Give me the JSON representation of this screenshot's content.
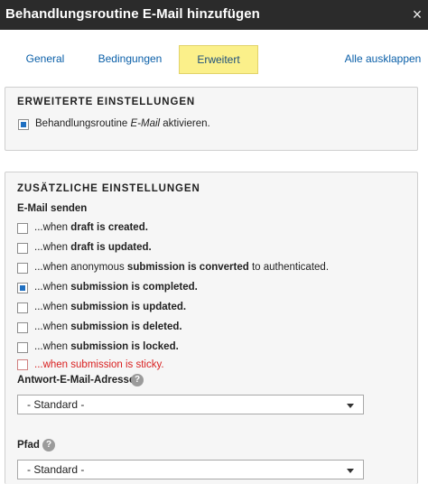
{
  "dialog": {
    "title": "Behandlungsroutine E-Mail hinzufügen",
    "close_icon": "×"
  },
  "tabs": [
    {
      "label": "General"
    },
    {
      "label": "Bedingungen"
    },
    {
      "label": "Erweitert",
      "active": true
    }
  ],
  "expand_all": "Alle ausklappen",
  "advanced": {
    "title": "ERWEITERTE EINSTELLUNGEN",
    "activate": {
      "pre": "Behandlungsroutine ",
      "em": "E-Mail",
      "post": " aktivieren.",
      "checked": true
    }
  },
  "additional": {
    "title": "ZUSÄTZLICHE EINSTELLUNGEN",
    "send_label": "E-Mail senden",
    "options": [
      {
        "pre": "...when ",
        "bold": "draft is created.",
        "post": "",
        "checked": false
      },
      {
        "pre": "...when ",
        "bold": "draft is updated.",
        "post": "",
        "checked": false
      },
      {
        "pre": "...when anonymous ",
        "bold": "submission is converted",
        "post": " to authenticated.",
        "checked": false
      },
      {
        "pre": "...when ",
        "bold": "submission is completed.",
        "post": "",
        "checked": true
      },
      {
        "pre": "...when ",
        "bold": "submission is updated.",
        "post": "",
        "checked": false
      },
      {
        "pre": "...when ",
        "bold": "submission is deleted.",
        "post": "",
        "checked": false
      },
      {
        "pre": "...when ",
        "bold": "submission is locked.",
        "post": "",
        "checked": false
      },
      {
        "pre": "...when submission is sticky.",
        "bold": "",
        "post": "",
        "checked": false
      }
    ],
    "reply_label": "Antwort-E-Mail-Adresse",
    "reply_value": "- Standard -",
    "path_label": "Pfad",
    "path_value": "- Standard -",
    "help_glyph": "?"
  },
  "colors": {
    "titlebar": "#2b2b2b",
    "active_tab": "#fbf08a",
    "link": "#0a5fa8",
    "checkbox_checked": "#1f6fc1",
    "warning_text": "#d92020"
  }
}
